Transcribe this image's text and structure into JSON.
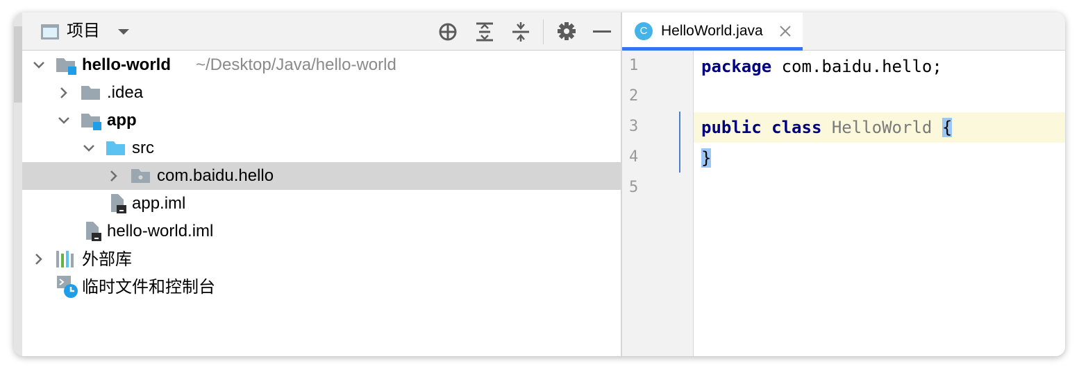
{
  "project_panel": {
    "title": "项目",
    "tree": [
      {
        "label": "hello-world",
        "path": "~/Desktop/Java/hello-world"
      },
      {
        "label": ".idea"
      },
      {
        "label": "app"
      },
      {
        "label": "src"
      },
      {
        "label": "com.baidu.hello"
      },
      {
        "label": "app.iml"
      },
      {
        "label": "hello-world.iml"
      },
      {
        "label": "外部库"
      },
      {
        "label": "临时文件和控制台"
      }
    ]
  },
  "editor": {
    "tab": {
      "icon_letter": "C",
      "title": "HelloWorld.java"
    },
    "line_numbers": [
      "1",
      "2",
      "3",
      "4",
      "5"
    ],
    "code": {
      "l1_kw": "package",
      "l1_rest": " com.baidu.hello;",
      "l3_kw1": "public",
      "l3_kw2": "class",
      "l3_class": "HelloWorld",
      "l3_brace": "{",
      "l4_brace": "}"
    }
  },
  "colors": {
    "accent": "#3574f0",
    "folder": "#9aa7b0",
    "source_folder": "#5cc2ef",
    "keyword": "#000080",
    "current_line": "#fcf8dc"
  }
}
